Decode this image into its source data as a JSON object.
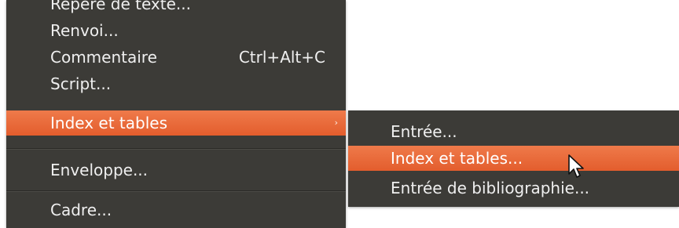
{
  "main_menu": {
    "items": [
      {
        "label": "Repère de texte..."
      },
      {
        "label": "Renvoi..."
      },
      {
        "label": "Commentaire",
        "shortcut": "Ctrl+Alt+C"
      },
      {
        "label": "Script..."
      },
      {
        "label": "Index et tables",
        "submenu_arrow": "›"
      },
      {
        "label": "Enveloppe..."
      },
      {
        "label": "Cadre..."
      }
    ]
  },
  "sub_menu": {
    "items": [
      {
        "label": "Entrée..."
      },
      {
        "label": "Index et tables..."
      },
      {
        "label": "Entrée de bibliographie..."
      }
    ]
  },
  "colors": {
    "menu_bg": "#3c3b37",
    "highlight": "#e86a3a",
    "text": "#efefef"
  }
}
